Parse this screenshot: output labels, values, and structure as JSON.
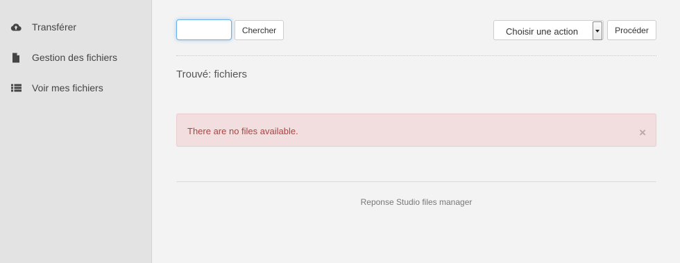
{
  "sidebar": {
    "items": [
      {
        "label": "Transférer",
        "icon": "cloud-upload-icon"
      },
      {
        "label": "Gestion des fichiers",
        "icon": "file-icon"
      },
      {
        "label": "Voir mes fichiers",
        "icon": "list-icon"
      }
    ]
  },
  "toolbar": {
    "search_value": "",
    "search_button_label": "Chercher",
    "action_select_value": "Choisir une action",
    "proceed_button_label": "Procéder"
  },
  "results": {
    "title": "Trouvé: fichiers"
  },
  "alert": {
    "message": "There are no files available.",
    "close_glyph": "×",
    "colors": {
      "background": "#f2dede",
      "text": "#a94442"
    }
  },
  "footer": {
    "text": "Reponse Studio files manager"
  }
}
